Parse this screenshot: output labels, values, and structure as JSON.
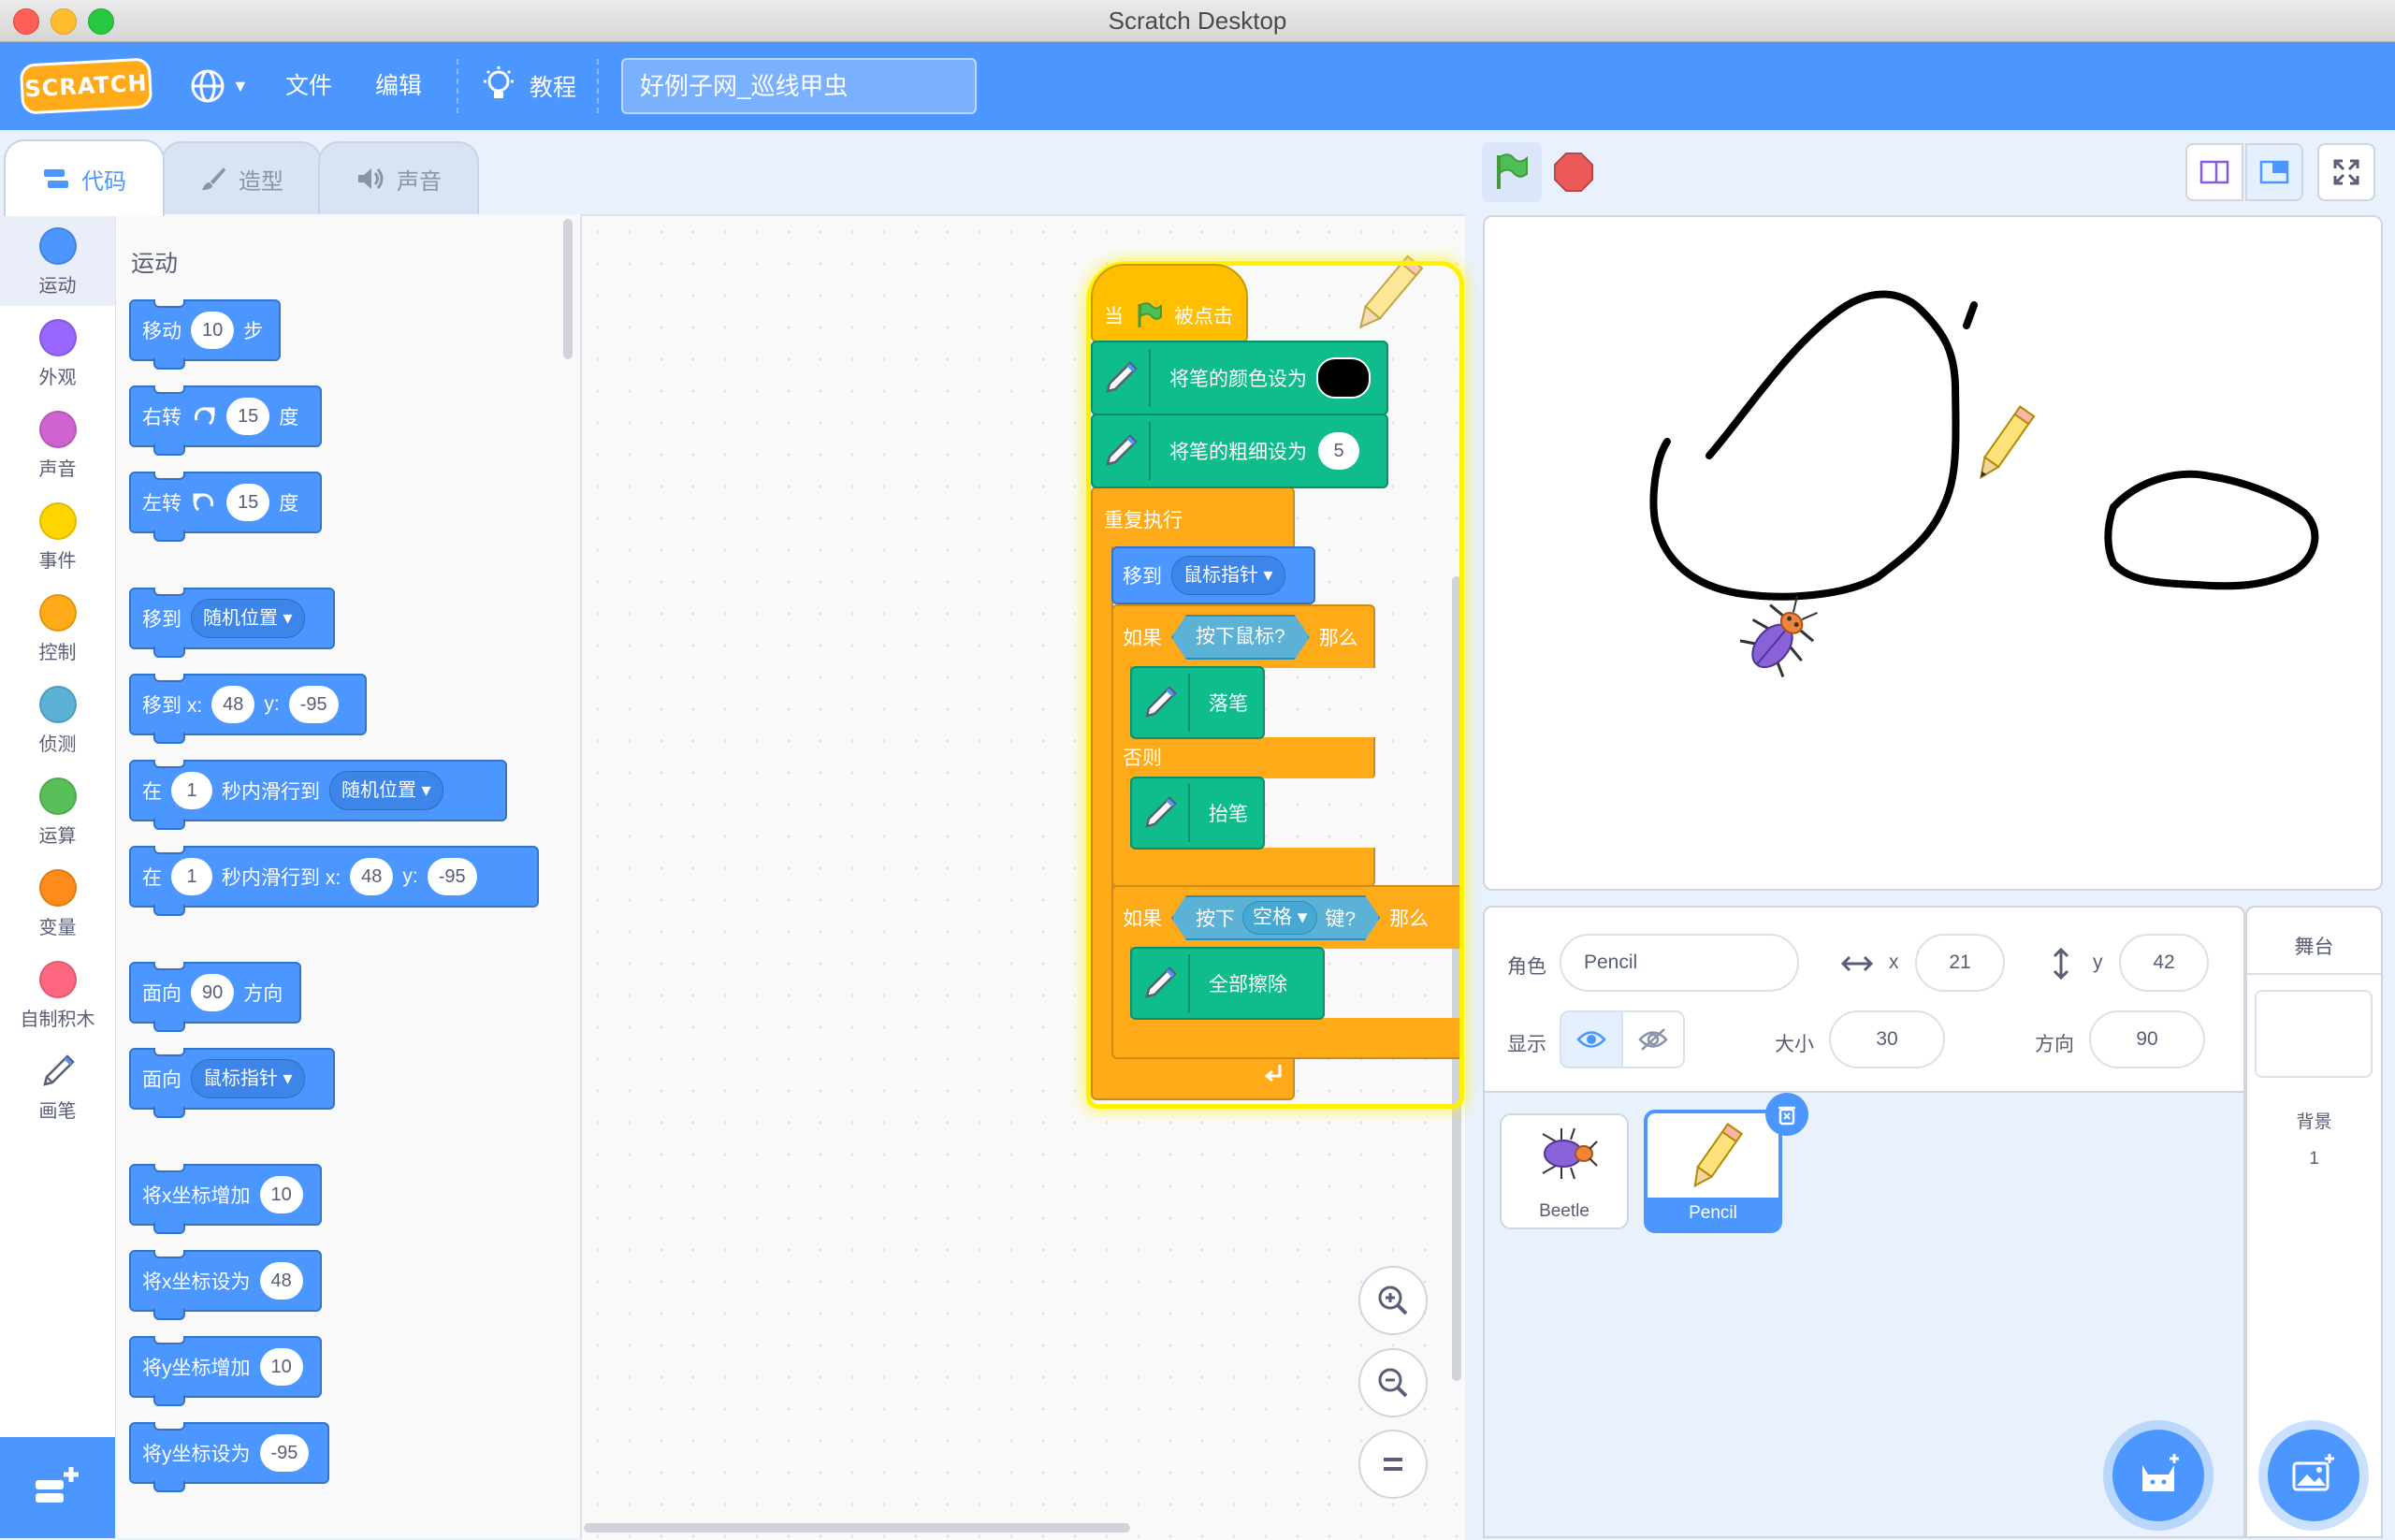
{
  "window": {
    "title": "Scratch Desktop"
  },
  "menubar": {
    "logo": "SCRATCH",
    "file": "文件",
    "edit": "编辑",
    "tutorials": "教程",
    "project_title": "好例子网_巡线甲虫"
  },
  "tabs": {
    "code": "代码",
    "costumes": "造型",
    "sounds": "声音"
  },
  "categories": [
    {
      "label": "运动",
      "color": "#4c97ff"
    },
    {
      "label": "外观",
      "color": "#9966ff"
    },
    {
      "label": "声音",
      "color": "#cf63cf"
    },
    {
      "label": "事件",
      "color": "#ffd500"
    },
    {
      "label": "控制",
      "color": "#ffab19"
    },
    {
      "label": "侦测",
      "color": "#5cb1d6"
    },
    {
      "label": "运算",
      "color": "#59c059"
    },
    {
      "label": "变量",
      "color": "#ff8c1a"
    },
    {
      "label": "自制积木",
      "color": "#ff6680"
    },
    {
      "label": "画笔",
      "color": "#0fbd8c"
    }
  ],
  "palette": {
    "heading": "运动",
    "move": {
      "a": "移动",
      "n": "10",
      "b": "步"
    },
    "turn_right": {
      "a": "右转",
      "n": "15",
      "b": "度"
    },
    "turn_left": {
      "a": "左转",
      "n": "15",
      "b": "度"
    },
    "goto": {
      "a": "移到",
      "d": "随机位置"
    },
    "goto_xy": {
      "a": "移到 x:",
      "x": "48",
      "b": "y:",
      "y": "-95"
    },
    "glide": {
      "a": "在",
      "n": "1",
      "b": "秒内滑行到",
      "d": "随机位置"
    },
    "glide_xy": {
      "a": "在",
      "n": "1",
      "b": "秒内滑行到 x:",
      "x": "48",
      "c": "y:",
      "y": "-95"
    },
    "point": {
      "a": "面向",
      "n": "90",
      "b": "方向"
    },
    "point_towards": {
      "a": "面向",
      "d": "鼠标指针"
    },
    "change_x": {
      "a": "将x坐标增加",
      "n": "10"
    },
    "set_x": {
      "a": "将x坐标设为",
      "n": "48"
    },
    "change_y": {
      "a": "将y坐标增加",
      "n": "10"
    },
    "set_y": {
      "a": "将y坐标设为",
      "n": "-95"
    }
  },
  "script": {
    "hat": {
      "a": "当",
      "b": "被点击"
    },
    "set_color": "将笔的颜色设为",
    "set_size": {
      "label": "将笔的粗细设为",
      "value": "5"
    },
    "forever": "重复执行",
    "goto": {
      "a": "移到",
      "d": "鼠标指针"
    },
    "if1": {
      "a": "如果",
      "cond": "按下鼠标?",
      "b": "那么"
    },
    "pen_down": "落笔",
    "else": "否则",
    "pen_up": "抬笔",
    "if2": {
      "a": "如果",
      "cond_a": "按下",
      "key": "空格",
      "cond_b": "键?",
      "b": "那么"
    },
    "clear": "全部擦除"
  },
  "sprite_info": {
    "sprite_label": "角色",
    "sprite_name": "Pencil",
    "x_label": "x",
    "x": "21",
    "y_label": "y",
    "y": "42",
    "show_label": "显示",
    "size_label": "大小",
    "size": "30",
    "direction_label": "方向",
    "direction": "90"
  },
  "sprites": [
    {
      "name": "Beetle",
      "selected": false
    },
    {
      "name": "Pencil",
      "selected": true
    }
  ],
  "stage_panel": {
    "title": "舞台",
    "backdrops_label": "背景",
    "backdrops_count": "1"
  },
  "colors": {
    "accent": "#4c97ff",
    "motion": "#4c97ff",
    "control": "#ffab19",
    "events": "#ffbf00",
    "pen": "#0fbd8c",
    "sensing": "#5cb1d6"
  }
}
